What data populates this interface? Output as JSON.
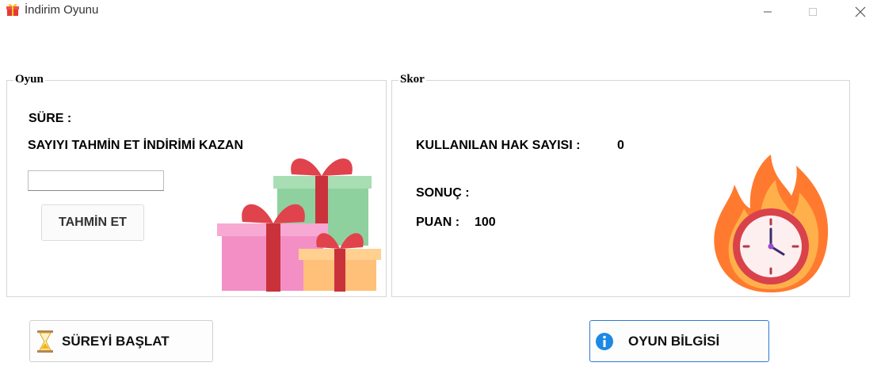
{
  "window": {
    "title": "İndirim Oyunu",
    "icons": [
      "gift-icon",
      "minimize-icon",
      "maximize-icon",
      "close-icon"
    ]
  },
  "game": {
    "legend": "Oyun",
    "time_label": "SÜRE :",
    "instruction": "SAYIYI TAHMİN ET İNDİRİMİ KAZAN",
    "guess_input": {
      "value": "",
      "placeholder": ""
    },
    "guess_button": "TAHMİN ET"
  },
  "score": {
    "legend": "Skor",
    "attempts_label": "KULLANILAN HAK SAYISI :",
    "attempts_value": "0",
    "result_label": "SONUÇ :",
    "points_label": "PUAN :",
    "points_value": "100"
  },
  "actions": {
    "start_label": "SÜREYİ BAŞLAT",
    "info_label": "OYUN BİLGİSİ"
  },
  "colors": {
    "focus_border": "#2a7ad6",
    "info_icon": "#1e88e5",
    "gift_pink": "#f48fc5",
    "gift_green": "#8fd19e",
    "gift_orange": "#ffc07a",
    "ribbon_red": "#d9343c",
    "flame_orange": "#ff7a2f",
    "clock_face": "#fdeef0"
  }
}
